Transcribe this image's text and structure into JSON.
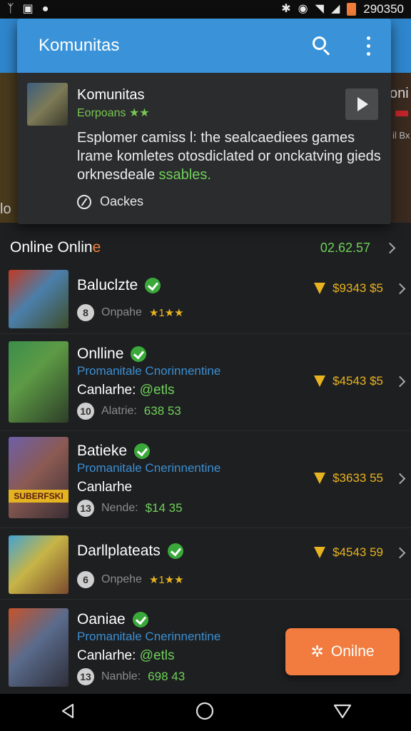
{
  "status_bar": {
    "left_icons": [
      "ᛉ",
      "▣",
      "●"
    ],
    "right_icons": [
      "bluetooth-icon",
      "vibrate-icon",
      "wifi-icon",
      "signal-icon",
      "battery-icon"
    ],
    "time": "290350"
  },
  "card": {
    "title": "Komunitas",
    "app_name": "Komunitas",
    "app_sub": "Eorpoans ★★",
    "description_main": "Esplomer camiss l: the sealcaediees games lrame komletes otosdiclated or onckatving gieds orknesdeale",
    "description_highlight": "ssables.",
    "footer_label": "Oackes"
  },
  "section": {
    "title_main": "Online Onlin",
    "title_accent": "e",
    "value": "02.62.57"
  },
  "items": [
    {
      "name": "Baluclzte",
      "badge_num": "8",
      "meta_label": "Onpahe",
      "rating": "★1★★",
      "price": "$9343  $5"
    },
    {
      "name": "Onlline",
      "sub": "Promanitale Cnorinnentine",
      "line": "Canlarhe:",
      "line_green": "@etls",
      "badge_num": "10",
      "meta_label": "Alatrie:",
      "meta_value": "638 53",
      "price": "$4543  $5"
    },
    {
      "name": "Batieke",
      "sub": "Promanitale Cnerinnentine",
      "line": "Canlarhe",
      "badge_num": "13",
      "meta_label": "Nende:",
      "meta_value": "$14 35",
      "price": "$3633  55",
      "banner": "SUBERFSKI"
    },
    {
      "name": "Darllplateats",
      "badge_num": "6",
      "meta_label": "Onpehe",
      "rating": "★1★★",
      "price": "$4543  59"
    },
    {
      "name": "Oaniae",
      "sub": "Promanitale Cnerinnentine",
      "line": "Canlarhe:",
      "line_green": "@etls",
      "badge_num": "13",
      "meta_label": "Nanble:",
      "meta_value": "698 43"
    }
  ],
  "fab": {
    "label": "Onilne",
    "icon": "gear-icon"
  },
  "hero_fragments": {
    "right_top": "oni",
    "right_sub": "il Bx",
    "left": "lo"
  },
  "colors": {
    "accent_blue": "#3a93d8",
    "accent_orange": "#f27c3f",
    "accent_green": "#6fd15a",
    "price_gold": "#e7b321"
  }
}
